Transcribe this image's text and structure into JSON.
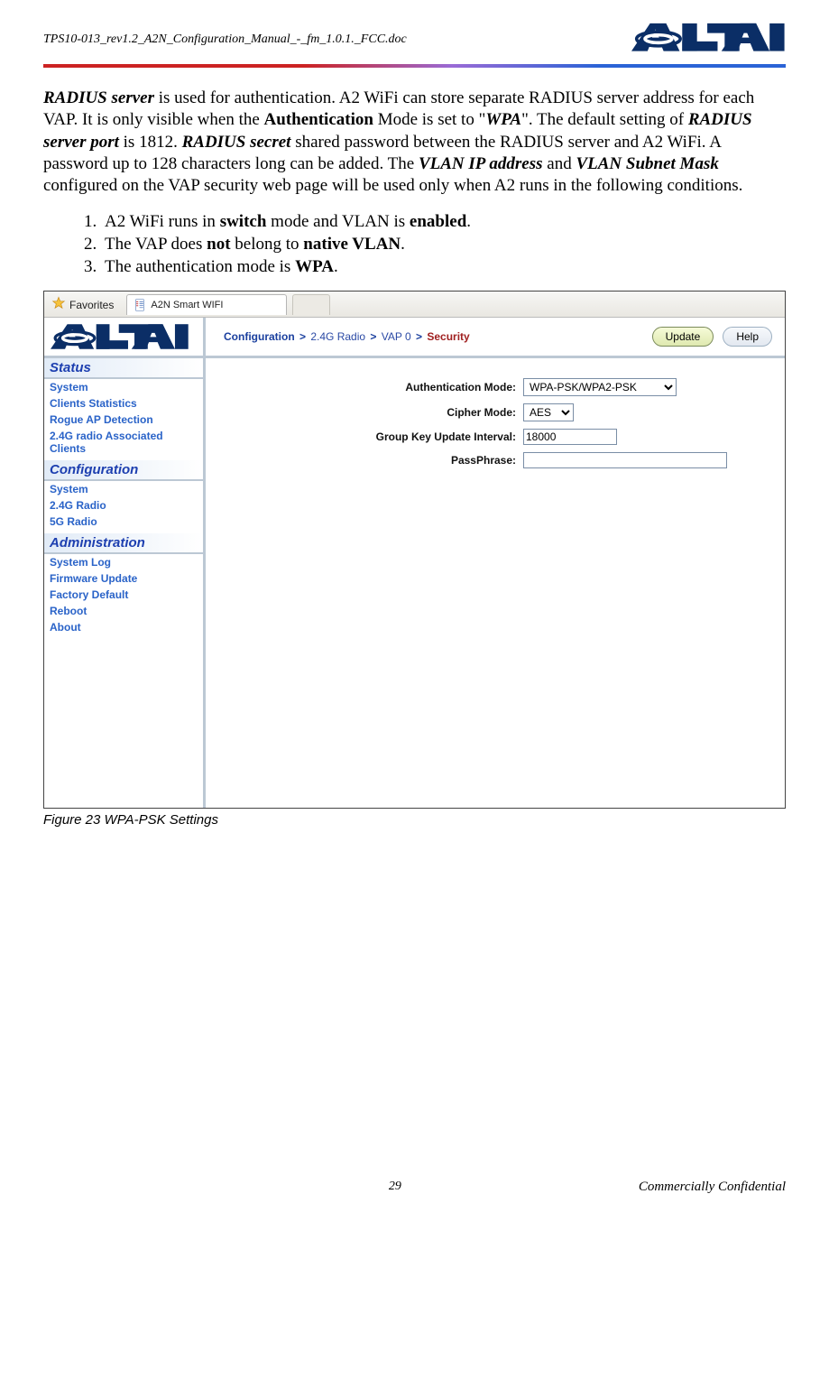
{
  "doc": {
    "id": "TPS10-013_rev1.2_A2N_Configuration_Manual_-_fm_1.0.1._FCC.doc",
    "page_number": "29",
    "confidential": "Commercially Confidential"
  },
  "para": {
    "t1": "RADIUS server",
    "t2": " is used for authentication. A2 WiFi can store separate RADIUS server address for each VAP. It is only visible when the ",
    "t3": "Authentication",
    "t4": " Mode is set to \"",
    "t5": "WPA",
    "t6": "\". The default setting of ",
    "t7": "RADIUS server port",
    "t8": " is 1812. ",
    "t9": "RADIUS secret",
    "t10": " shared password between the RADIUS server and A2 WiFi. A password up to 128 characters long can be added. The ",
    "t11": "VLAN IP address",
    "t12": " and ",
    "t13": "VLAN Subnet Mask",
    "t14": " configured on the VAP security web page will be used only when A2 runs in the following conditions."
  },
  "list": {
    "l1a": "A2 WiFi runs in ",
    "l1b": "switch",
    "l1c": " mode and VLAN is ",
    "l1d": "enabled",
    "l1e": ".",
    "l2a": "The VAP does ",
    "l2b": "not",
    "l2c": " belong to ",
    "l2d": "native VLAN",
    "l2e": ".",
    "l3a": "The authentication mode is ",
    "l3b": "WPA",
    "l3c": "."
  },
  "shot": {
    "fav_label": "Favorites",
    "tab_title": "A2N Smart WIFI",
    "crumb": {
      "c1": "Configuration",
      "c2": "2.4G Radio",
      "c3": "VAP 0",
      "c4": "Security"
    },
    "btn_update": "Update",
    "btn_help": "Help",
    "sidebar": {
      "status": "Status",
      "config": "Configuration",
      "admin": "Administration",
      "items": {
        "s1": "System",
        "s2": "Clients Statistics",
        "s3": "Rogue AP Detection",
        "s4": "2.4G radio Associated Clients",
        "c1": "System",
        "c2": "2.4G Radio",
        "c3": "5G Radio",
        "a1": "System Log",
        "a2": "Firmware Update",
        "a3": "Factory Default",
        "a4": "Reboot",
        "a5": "About"
      }
    },
    "form": {
      "auth_label": "Authentication Mode:",
      "auth_value": "WPA-PSK/WPA2-PSK",
      "cipher_label": "Cipher Mode:",
      "cipher_value": "AES",
      "gku_label": "Group Key Update Interval:",
      "gku_value": "18000",
      "pass_label": "PassPhrase:",
      "pass_value": ""
    }
  },
  "caption": "Figure 23     WPA-PSK Settings"
}
